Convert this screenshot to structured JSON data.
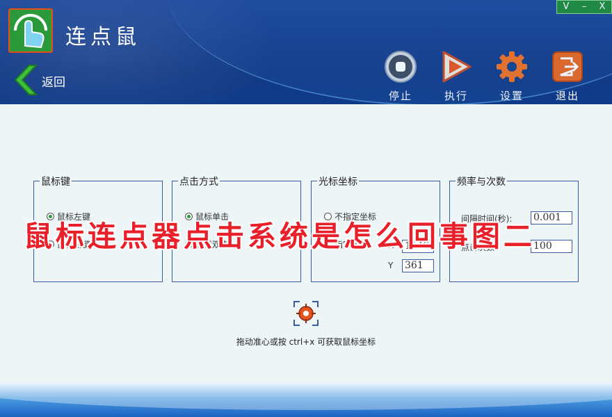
{
  "window": {
    "title": "连点鼠",
    "controls": {
      "restore": "V",
      "minimize": "–",
      "close": "X"
    }
  },
  "header": {
    "back_label": "返回",
    "toolbar": [
      {
        "id": "stop",
        "label": "停止",
        "icon": "stop-icon"
      },
      {
        "id": "run",
        "label": "执行",
        "icon": "play-icon"
      },
      {
        "id": "settings",
        "label": "设置",
        "icon": "gear-icon"
      },
      {
        "id": "exit",
        "label": "退出",
        "icon": "exit-icon"
      }
    ]
  },
  "groups": {
    "mouse_key": {
      "title": "鼠标键",
      "options": [
        {
          "label": "鼠标左键",
          "selected": true
        },
        {
          "label": "鼠标右键",
          "selected": false
        }
      ]
    },
    "click_mode": {
      "title": "点击方式",
      "options": [
        {
          "label": "鼠标单击",
          "selected": true
        },
        {
          "label": "鼠标双击",
          "selected": false
        }
      ]
    },
    "cursor_coord": {
      "title": "光标坐标",
      "options": [
        {
          "label": "不指定坐标",
          "selected": false
        },
        {
          "label": "指定坐标",
          "selected": true
        }
      ],
      "x_label": "X",
      "x_value": "1549",
      "y_label": "Y",
      "y_value": "361"
    },
    "frequency": {
      "title": "频率与次数",
      "interval_label": "间隔时间(秒):",
      "interval_value": "0.001",
      "count_label": "点击次数:",
      "count_value": "100"
    }
  },
  "hint": "拖动准心或按 ctrl+x 可获取鼠标坐标",
  "watermark": "鼠标连点器点击系统是怎么回事图二",
  "colors": {
    "header": "#163f8e",
    "accent_green": "#2a9a3a",
    "watermark_red": "#e8202a",
    "border_blue": "#3a58a8"
  }
}
